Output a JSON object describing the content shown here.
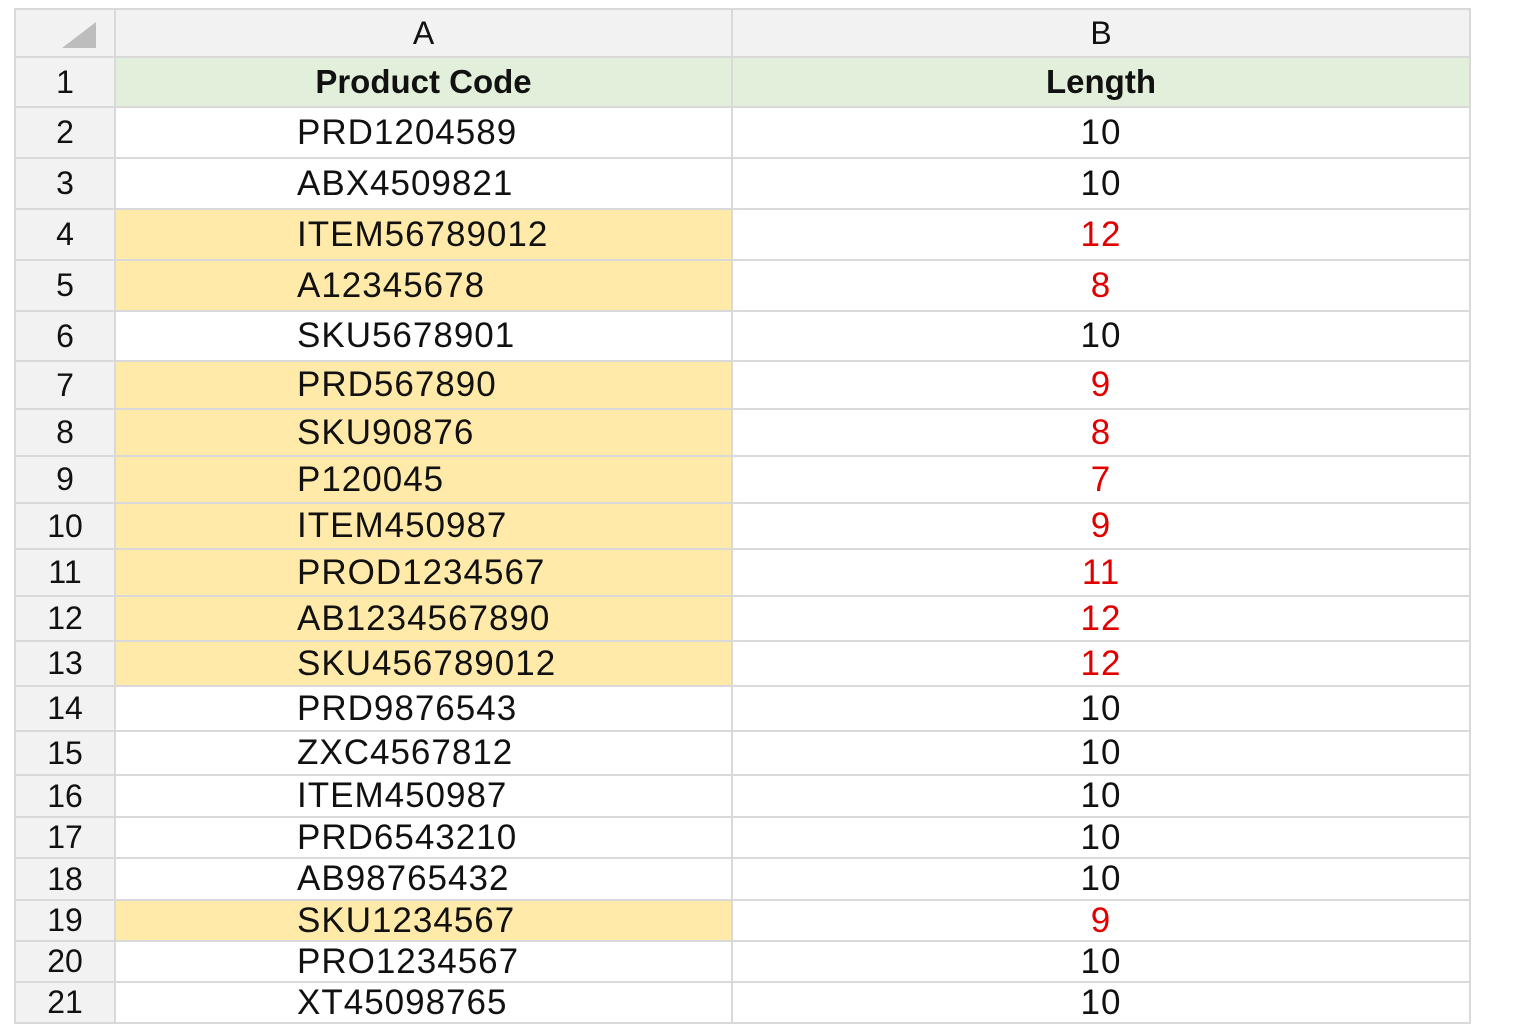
{
  "sheet": {
    "columns": [
      "A",
      "B"
    ],
    "headers": [
      "Product Code",
      "Length"
    ],
    "header_row_number": "1",
    "highlight_color": "#ffeaa9",
    "header_fill_color": "#e2efda",
    "mismatch_text_color": "#e00000",
    "corner_icon": "select-all-triangle-icon",
    "rows": [
      {
        "num": "2",
        "code": "PRD1204589",
        "length": "10",
        "flag": false
      },
      {
        "num": "3",
        "code": "ABX4509821",
        "length": "10",
        "flag": false
      },
      {
        "num": "4",
        "code": "ITEM56789012",
        "length": "12",
        "flag": true
      },
      {
        "num": "5",
        "code": "A12345678",
        "length": "8",
        "flag": true
      },
      {
        "num": "6",
        "code": "SKU5678901",
        "length": "10",
        "flag": false
      },
      {
        "num": "7",
        "code": "PRD567890",
        "length": "9",
        "flag": true
      },
      {
        "num": "8",
        "code": "SKU90876",
        "length": "8",
        "flag": true
      },
      {
        "num": "9",
        "code": "P120045",
        "length": "7",
        "flag": true
      },
      {
        "num": "10",
        "code": "ITEM450987",
        "length": "9",
        "flag": true
      },
      {
        "num": "11",
        "code": "PROD1234567",
        "length": "11",
        "flag": true
      },
      {
        "num": "12",
        "code": "AB1234567890",
        "length": "12",
        "flag": true
      },
      {
        "num": "13",
        "code": "SKU456789012",
        "length": "12",
        "flag": true
      },
      {
        "num": "14",
        "code": "PRD9876543",
        "length": "10",
        "flag": false
      },
      {
        "num": "15",
        "code": "ZXC4567812",
        "length": "10",
        "flag": false
      },
      {
        "num": "16",
        "code": "ITEM450987",
        "length": "10",
        "flag": false
      },
      {
        "num": "17",
        "code": "PRD6543210",
        "length": "10",
        "flag": false
      },
      {
        "num": "18",
        "code": "AB98765432",
        "length": "10",
        "flag": false
      },
      {
        "num": "19",
        "code": "SKU1234567",
        "length": "9",
        "flag": true
      },
      {
        "num": "20",
        "code": "PRO1234567",
        "length": "10",
        "flag": false
      },
      {
        "num": "21",
        "code": "XT45098765",
        "length": "10",
        "flag": false
      }
    ]
  }
}
